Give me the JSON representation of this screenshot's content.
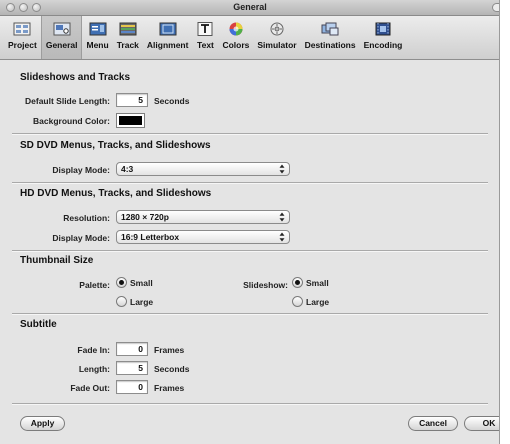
{
  "window": {
    "title": "General"
  },
  "toolbar": {
    "items": [
      {
        "label": "Project",
        "icon": "project-icon"
      },
      {
        "label": "General",
        "icon": "general-icon",
        "selected": true
      },
      {
        "label": "Menu",
        "icon": "menu-icon"
      },
      {
        "label": "Track",
        "icon": "track-icon"
      },
      {
        "label": "Alignment",
        "icon": "alignment-icon"
      },
      {
        "label": "Text",
        "icon": "text-icon"
      },
      {
        "label": "Colors",
        "icon": "colors-icon"
      },
      {
        "label": "Simulator",
        "icon": "simulator-icon"
      },
      {
        "label": "Destinations",
        "icon": "destinations-icon"
      },
      {
        "label": "Encoding",
        "icon": "encoding-icon"
      }
    ]
  },
  "slideshows": {
    "heading": "Slideshows and Tracks",
    "slide_length_label": "Default Slide Length:",
    "slide_length_value": "5",
    "slide_length_unit": "Seconds",
    "bg_color_label": "Background Color:",
    "bg_color": "#000000"
  },
  "sd": {
    "heading": "SD DVD Menus, Tracks, and Slideshows",
    "display_mode_label": "Display Mode:",
    "display_mode_value": "4:3"
  },
  "hd": {
    "heading": "HD DVD Menus, Tracks, and Slideshows",
    "resolution_label": "Resolution:",
    "resolution_value": "1280 × 720p",
    "display_mode_label": "Display Mode:",
    "display_mode_value": "16:9 Letterbox"
  },
  "thumbnail": {
    "heading": "Thumbnail Size",
    "palette_label": "Palette:",
    "palette_options": [
      "Small",
      "Large"
    ],
    "palette_selected": "Small",
    "slideshow_label": "Slideshow:",
    "slideshow_options": [
      "Small",
      "Large"
    ],
    "slideshow_selected": "Small"
  },
  "subtitle": {
    "heading": "Subtitle",
    "fade_in_label": "Fade In:",
    "fade_in_value": "0",
    "fade_in_unit": "Frames",
    "length_label": "Length:",
    "length_value": "5",
    "length_unit": "Seconds",
    "fade_out_label": "Fade Out:",
    "fade_out_value": "0",
    "fade_out_unit": "Frames"
  },
  "footer": {
    "apply_label": "Apply",
    "cancel_label": "Cancel",
    "ok_label": "OK"
  }
}
